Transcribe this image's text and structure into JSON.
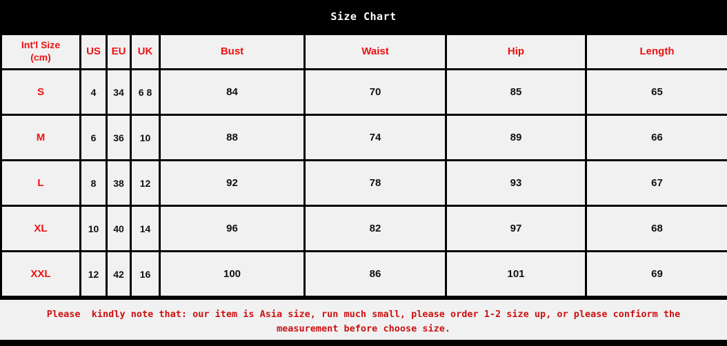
{
  "title": {
    "text": "Size Chart",
    "text_color": "#ffffff",
    "band_color": "#000000"
  },
  "colors": {
    "header_text": "#ee1111",
    "size_label_text": "#ee1111",
    "value_text": "#101010",
    "cell_background": "#f1f1f1",
    "grid_line": "#000000",
    "note_text": "#cc1111"
  },
  "table": {
    "columns": [
      {
        "key": "intl_size",
        "label": "Int'l Size",
        "label_line2": "(cm)"
      },
      {
        "key": "us",
        "label": "US"
      },
      {
        "key": "eu",
        "label": "EU"
      },
      {
        "key": "uk",
        "label": "UK"
      },
      {
        "key": "bust",
        "label": "Bust"
      },
      {
        "key": "waist",
        "label": "Waist"
      },
      {
        "key": "hip",
        "label": "Hip"
      },
      {
        "key": "length",
        "label": "Length"
      }
    ],
    "rows": [
      {
        "intl_size": "S",
        "us": "4",
        "eu": "34",
        "uk": "6 8",
        "bust": "84",
        "waist": "70",
        "hip": "85",
        "length": "65"
      },
      {
        "intl_size": "M",
        "us": "6",
        "eu": "36",
        "uk": "10",
        "bust": "88",
        "waist": "74",
        "hip": "89",
        "length": "66"
      },
      {
        "intl_size": "L",
        "us": "8",
        "eu": "38",
        "uk": "12",
        "bust": "92",
        "waist": "78",
        "hip": "93",
        "length": "67"
      },
      {
        "intl_size": "XL",
        "us": "10",
        "eu": "40",
        "uk": "14",
        "bust": "96",
        "waist": "82",
        "hip": "97",
        "length": "68"
      },
      {
        "intl_size": "XXL",
        "us": "12",
        "eu": "42",
        "uk": "16",
        "bust": "100",
        "waist": "86",
        "hip": "101",
        "length": "69"
      }
    ]
  },
  "note": {
    "text": "Please  kindly note that: our item is Asia size, run much small, please order 1-2 size up, or please confiorm the\nmeasurement before choose size."
  },
  "chart_data": {
    "type": "table",
    "title": "Size Chart",
    "columns": [
      "Int'l Size (cm)",
      "US",
      "EU",
      "UK",
      "Bust",
      "Waist",
      "Hip",
      "Length"
    ],
    "rows": [
      [
        "S",
        "4",
        "34",
        "6 8",
        "84",
        "70",
        "85",
        "65"
      ],
      [
        "M",
        "6",
        "36",
        "10",
        "88",
        "74",
        "89",
        "66"
      ],
      [
        "L",
        "8",
        "38",
        "12",
        "92",
        "78",
        "93",
        "67"
      ],
      [
        "XL",
        "10",
        "40",
        "14",
        "96",
        "82",
        "97",
        "68"
      ],
      [
        "XXL",
        "12",
        "42",
        "16",
        "100",
        "86",
        "101",
        "69"
      ]
    ],
    "units": "cm",
    "annotations": [
      "Please  kindly note that: our item is Asia size, run much small, please order 1-2 size up, or please confiorm the measurement before choose size."
    ]
  }
}
